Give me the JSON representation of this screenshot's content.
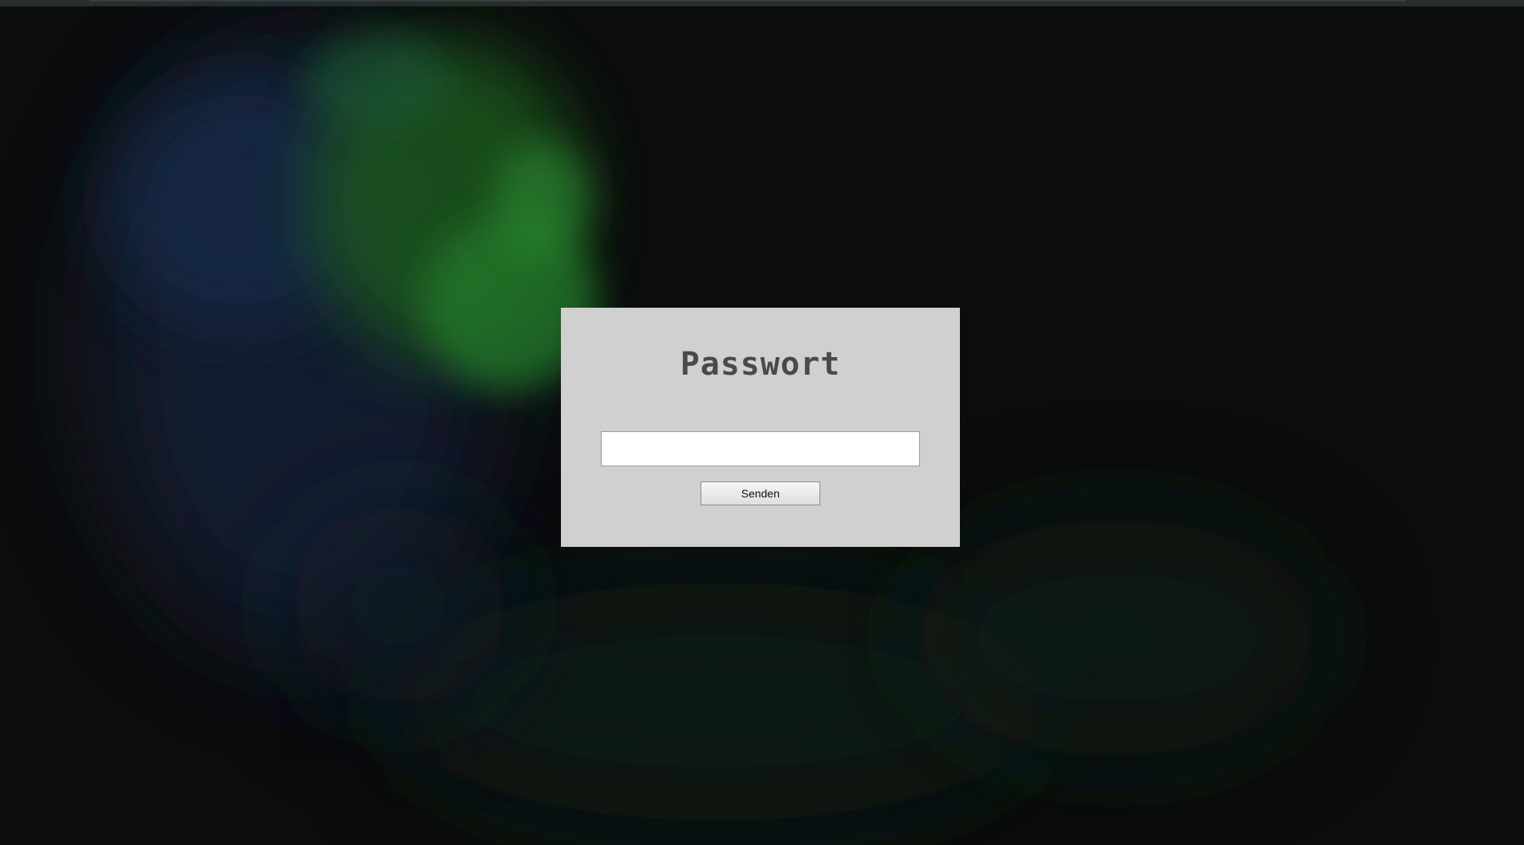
{
  "login": {
    "title": "Passwort",
    "password_value": "",
    "submit_label": "Senden"
  },
  "colors": {
    "page_background": "#0c0d0d",
    "panel_background": "#d0d0d0",
    "title_color": "#4a4a4a",
    "glow_green": "#1f6b22",
    "glow_blue": "#1c2a4a"
  }
}
